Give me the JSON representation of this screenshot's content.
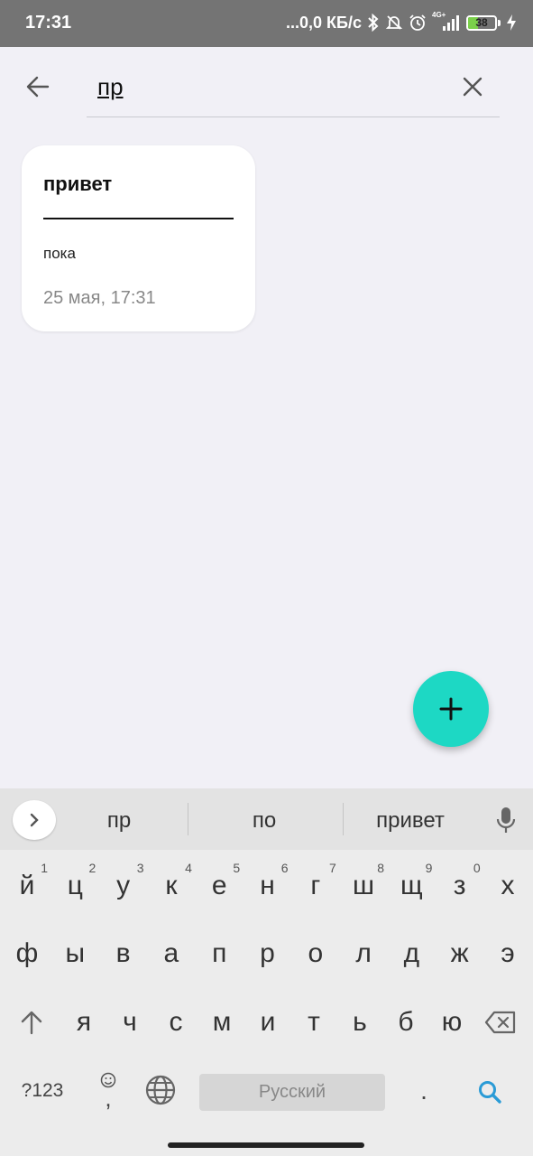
{
  "status_bar": {
    "time": "17:31",
    "network_speed": "...0,0 КБ/с",
    "signal_label": "4G+",
    "battery_level": "38",
    "battery_fraction": 0.38,
    "icons": [
      "bluetooth-icon",
      "bell-off-icon",
      "alarm-icon",
      "signal-icon",
      "battery-icon",
      "charging-icon"
    ]
  },
  "search": {
    "value": "пр",
    "back_icon": "arrow-left-icon",
    "clear_icon": "close-icon"
  },
  "notes": [
    {
      "title": "привет",
      "body": "пока",
      "date": "25 мая, 17:31"
    }
  ],
  "fab": {
    "icon": "plus-icon",
    "color": "#1dd8c4"
  },
  "keyboard": {
    "suggestions": [
      "пр",
      "по",
      "привет"
    ],
    "row1": [
      "й",
      "ц",
      "у",
      "к",
      "е",
      "н",
      "г",
      "ш",
      "щ",
      "з",
      "х"
    ],
    "row1_hints": [
      "1",
      "2",
      "3",
      "4",
      "5",
      "6",
      "7",
      "8",
      "9",
      "0",
      ""
    ],
    "row2": [
      "ф",
      "ы",
      "в",
      "а",
      "п",
      "р",
      "о",
      "л",
      "д",
      "ж",
      "э"
    ],
    "row3": [
      "я",
      "ч",
      "с",
      "м",
      "и",
      "т",
      "ь",
      "б",
      "ю"
    ],
    "symbols_label": "?123",
    "comma_label": ",",
    "space_label": "Русский",
    "period_label": ".",
    "accent_color": "#2a9bd6"
  }
}
